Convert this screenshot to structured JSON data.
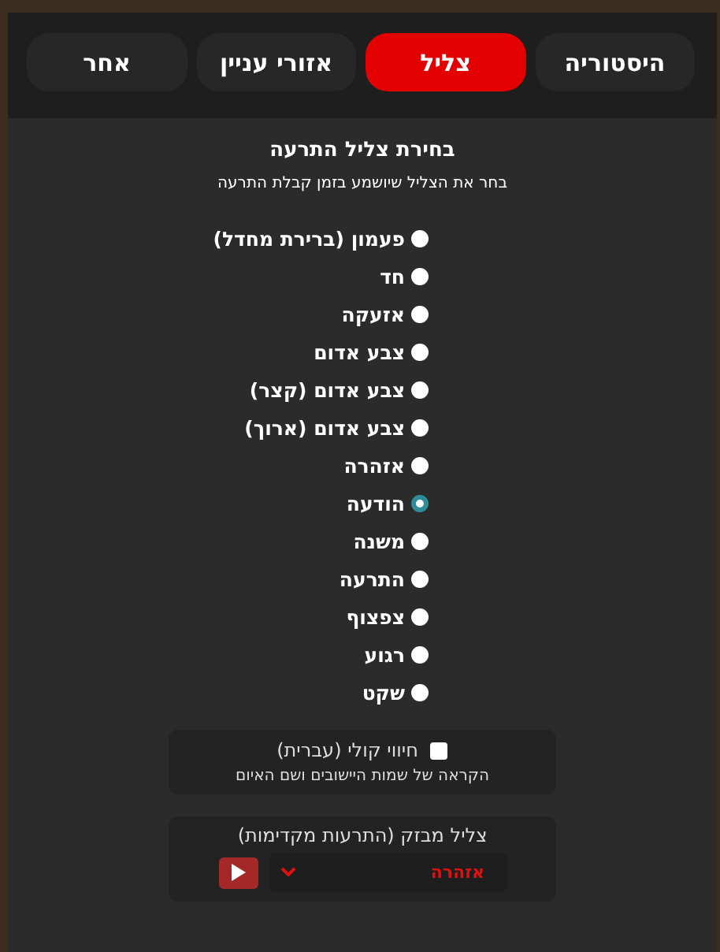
{
  "tabs": [
    {
      "label": "היסטוריה",
      "selected": false
    },
    {
      "label": "צליל",
      "selected": true
    },
    {
      "label": "אזורי עניין",
      "selected": false
    },
    {
      "label": "אחר",
      "selected": false
    }
  ],
  "section": {
    "title": "בחירת צליל התרעה",
    "subtitle": "בחר את הצליל שיושמע בזמן קבלת התרעה"
  },
  "sounds": [
    {
      "label": "פעמון (ברירת מחדל)",
      "selected": false
    },
    {
      "label": "חד",
      "selected": false
    },
    {
      "label": "אזעקה",
      "selected": false
    },
    {
      "label": "צבע אדום",
      "selected": false
    },
    {
      "label": "צבע אדום (קצר)",
      "selected": false
    },
    {
      "label": "צבע אדום (ארוך)",
      "selected": false
    },
    {
      "label": "אזהרה",
      "selected": false
    },
    {
      "label": "הודעה",
      "selected": true
    },
    {
      "label": "משנה",
      "selected": false
    },
    {
      "label": "התרעה",
      "selected": false
    },
    {
      "label": "צפצוף",
      "selected": false
    },
    {
      "label": "רגוע",
      "selected": false
    },
    {
      "label": "שקט",
      "selected": false
    }
  ],
  "voice": {
    "label": "חיווי קולי (עברית)",
    "checked": false,
    "description": "הקראה של שמות היישובים ושם האיום"
  },
  "early_sound": {
    "label": "צליל מבזק (התרעות מקדימות)",
    "value": "אזהרה"
  }
}
